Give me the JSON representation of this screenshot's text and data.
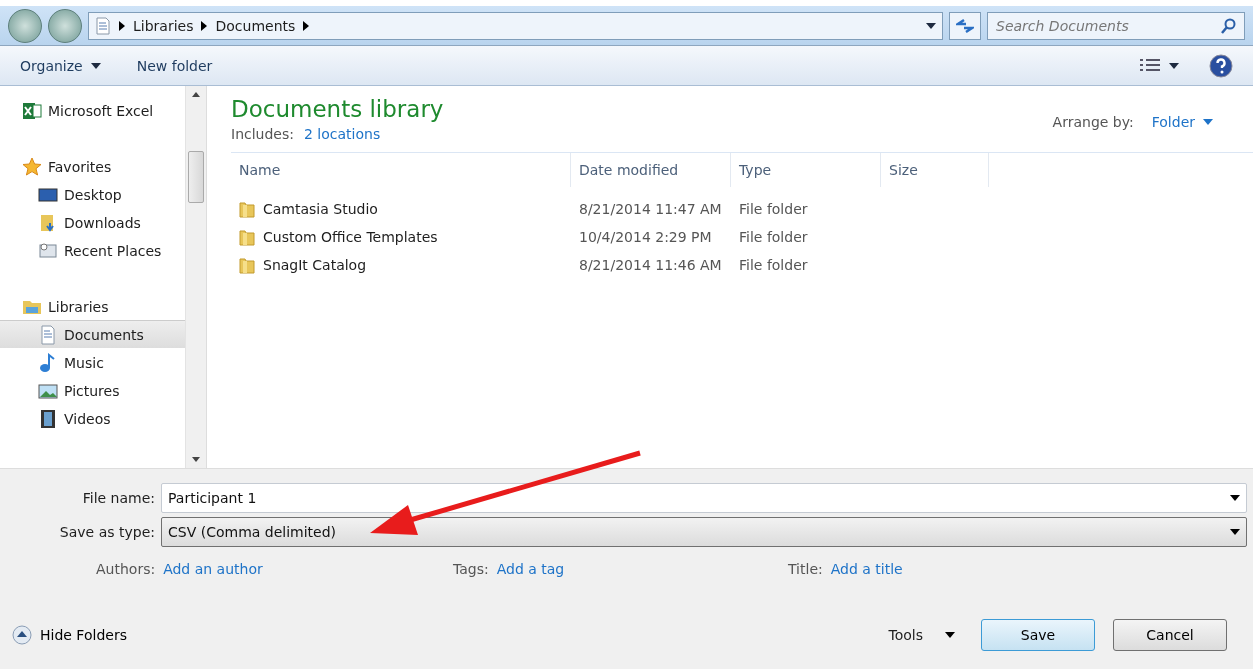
{
  "address_bar": {
    "crumbs": [
      "Libraries",
      "Documents"
    ],
    "search_placeholder": "Search Documents"
  },
  "toolbar": {
    "organize": "Organize",
    "new_folder": "New folder"
  },
  "sidebar": {
    "items": [
      {
        "label": "Microsoft Excel",
        "kind": "excel",
        "selected": false
      },
      {
        "label": "Favorites",
        "kind": "star",
        "selected": false,
        "children": [
          {
            "label": "Desktop",
            "kind": "desktop",
            "selected": false
          },
          {
            "label": "Downloads",
            "kind": "downloads",
            "selected": false
          },
          {
            "label": "Recent Places",
            "kind": "recent",
            "selected": false
          }
        ]
      },
      {
        "label": "Libraries",
        "kind": "library",
        "selected": false,
        "children": [
          {
            "label": "Documents",
            "kind": "document",
            "selected": true
          },
          {
            "label": "Music",
            "kind": "music",
            "selected": false
          },
          {
            "label": "Pictures",
            "kind": "pictures",
            "selected": false
          },
          {
            "label": "Videos",
            "kind": "videos",
            "selected": false
          }
        ]
      }
    ]
  },
  "library": {
    "title": "Documents library",
    "includes_label": "Includes:",
    "includes_link": "2 locations",
    "arrange_label": "Arrange by:",
    "arrange_value": "Folder"
  },
  "table": {
    "columns": [
      "Name",
      "Date modified",
      "Type",
      "Size"
    ],
    "rows": [
      [
        "Camtasia Studio",
        "8/21/2014 11:47 AM",
        "File folder"
      ],
      [
        "Custom Office Templates",
        "10/4/2014 2:29 PM",
        "File folder"
      ],
      [
        "SnagIt Catalog",
        "8/21/2014 11:46 AM",
        "File folder"
      ]
    ]
  },
  "form": {
    "file_name_label": "File name:",
    "file_name": "Participant 1",
    "type_label": "Save as type:",
    "type_value": "CSV (Comma delimited)",
    "meta": [
      {
        "label": "Authors:",
        "link": "Add an author"
      },
      {
        "label": "Tags:",
        "link": "Add a tag"
      },
      {
        "label": "Title:",
        "link": "Add a title"
      }
    ]
  },
  "footer": {
    "hide_folders": "Hide Folders",
    "tools": "Tools",
    "save": "Save",
    "cancel": "Cancel"
  }
}
